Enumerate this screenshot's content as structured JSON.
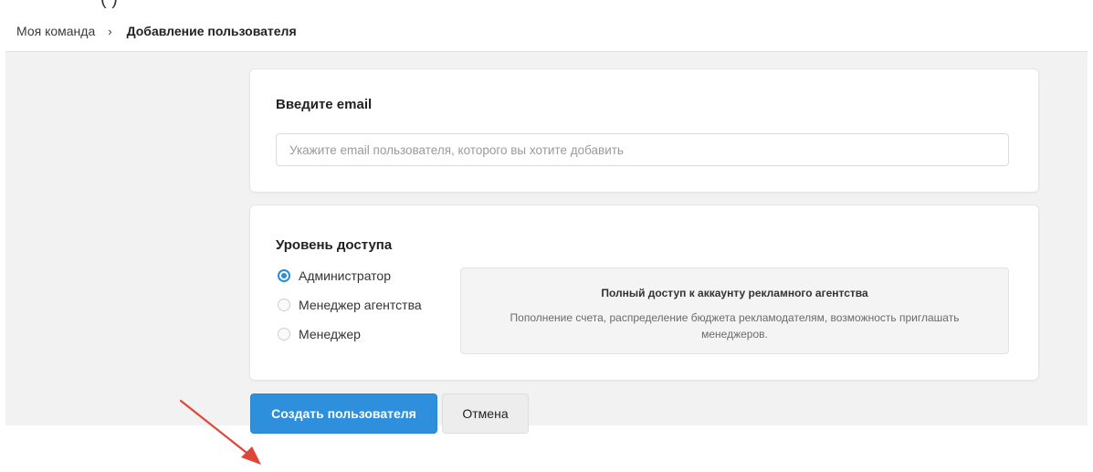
{
  "top_strip_text": "(          )",
  "breadcrumb": {
    "parent": "Моя команда",
    "separator": "›",
    "current": "Добавление пользователя"
  },
  "email_card": {
    "title": "Введите email",
    "input_value": "",
    "input_placeholder": "Укажите email пользователя, которого вы хотите добавить"
  },
  "access_card": {
    "title": "Уровень доступа",
    "options": [
      {
        "label": "Администратор",
        "selected": true
      },
      {
        "label": "Менеджер агентства",
        "selected": false
      },
      {
        "label": "Менеджер",
        "selected": false
      }
    ],
    "description": {
      "title": "Полный доступ к аккаунту рекламного агентства",
      "text": "Пополнение счета, распределение бюджета рекламодателям, возможность приглашать менеджеров."
    }
  },
  "actions": {
    "create_label": "Создать пользователя",
    "cancel_label": "Отмена"
  },
  "colors": {
    "accent": "#2e8fdc",
    "annotation_arrow": "#e0453a"
  },
  "icons": {
    "breadcrumb_separator": "chevron-right-icon",
    "annotation": "red-arrow-icon"
  }
}
